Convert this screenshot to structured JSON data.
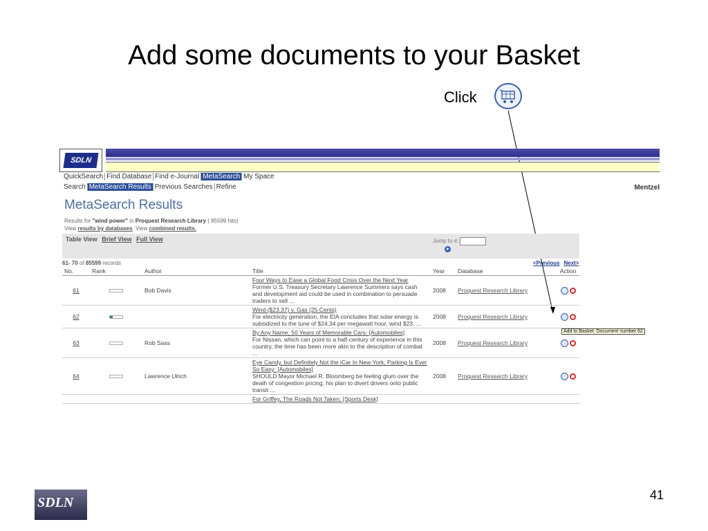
{
  "slide": {
    "title": "Add some documents to your Basket",
    "click_label": "Click",
    "page_number": "41",
    "footer_logo": "SDLN"
  },
  "app": {
    "logo": "SDLN",
    "username": "Mentzel",
    "nav_tabs": [
      "QuickSearch",
      "Find Database",
      "Find e-Journal",
      "MetaSearch",
      "My Space"
    ],
    "active_nav": "MetaSearch",
    "sub_tabs": [
      "Search",
      "MetaSearch Results",
      "Previous Searches",
      "Refine"
    ],
    "active_sub": "MetaSearch Results",
    "heading": "MetaSearch Results",
    "results_prefix": "Results for ",
    "query": "\"wind power\"",
    "results_in": " in ",
    "library": "Proquest Research Library",
    "hits": " ( 85599 hits)",
    "view_prefix": "View ",
    "view_link1": "results by databases",
    "view_mid": ". View ",
    "view_link2": "combined results.",
    "view_options": [
      "Table View",
      "Brief View",
      "Full View"
    ],
    "jump_label": "Jump to #:",
    "records_range": "61- 70",
    "records_of": " of ",
    "records_total": "85599",
    "records_suffix": " records",
    "prev_label": "<Previous",
    "next_label": "Next>",
    "columns": [
      "No.",
      "Rank",
      "Author",
      "Title",
      "Year",
      "Database",
      "Action"
    ],
    "tooltip": "Add to Basket: Document number 62",
    "rows": [
      {
        "no": "61",
        "rank": 0.0,
        "author": "Bob Davis",
        "title": "Four Ways to Ease a Global Food Crisis Over the Next Year",
        "snippet": "Former U.S. Treasury Secretary Lawrence Summers says cash and development aid could be used in combination to persuade traders to sell ...",
        "year": "2008",
        "db": "Proquest Research Library"
      },
      {
        "no": "62",
        "rank": 0.2,
        "author": "",
        "title": "Wind ($23.37) v. Gas (25 Cents)",
        "snippet": "For electricity generation, the EIA concludes that solar energy is subsidized to the tune of $24.34 per megawatt hour, wind $23. ...",
        "year": "2008",
        "db": "Proquest Research Library"
      },
      {
        "no": "63",
        "rank": 0.0,
        "author": "Rob Sass",
        "title": "By Any Name, 50 Years of Memorable Cars: [Automobiles]",
        "snippet": "For Nissan, which can point to a half-century of experience in this country, the time has been more akin to the description of combat ...",
        "year": "2008",
        "db": "Proquest Research Library"
      },
      {
        "no": "64",
        "rank": 0.0,
        "author": "Lawrence Ulrich",
        "title": "Eye Candy, but Definitely Not the iCar In New York, Parking Is Ever So Easy: [Automobiles]",
        "snippet": "SHOULD Mayor Michael R. Bloomberg be feeling glum over the death of congestion pricing, his plan to divert drivers onto public transit ...",
        "year": "2008",
        "db": "Proquest Research Library"
      },
      {
        "no": "",
        "rank": 0.0,
        "author": "",
        "title": "For Griffey, The Roads Not Taken: [Sports Desk]",
        "snippet": "",
        "year": "",
        "db": ""
      }
    ]
  }
}
